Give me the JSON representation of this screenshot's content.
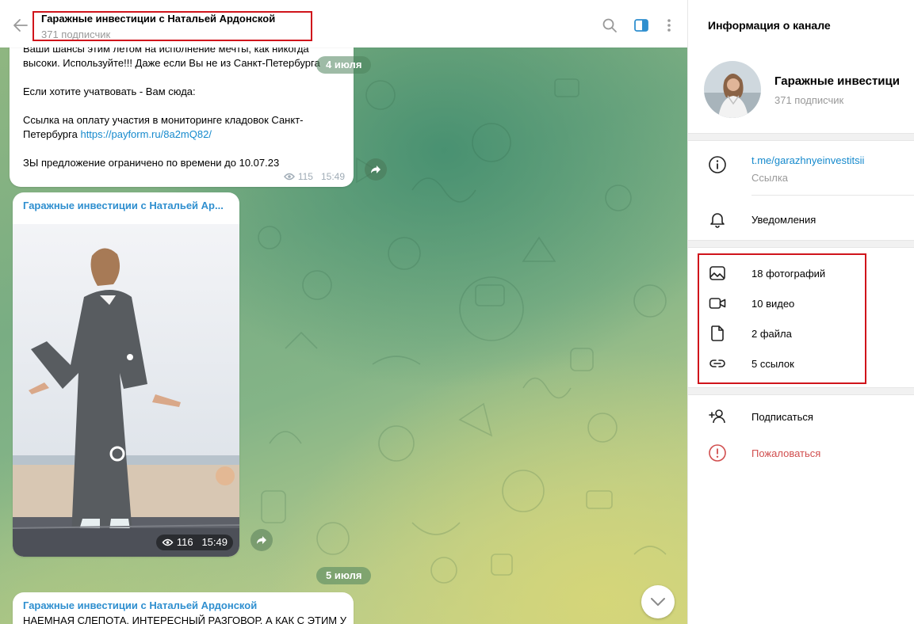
{
  "header": {
    "title": "Гаражные инвестиции с Натальей Ардонской",
    "subtitle": "371 подписчик"
  },
  "messages": {
    "m1": {
      "lines": [
        "Ваши шансы этим летом на исполнение мечты, как никогда",
        "высоки. Используйте!!! Даже если Вы не из Санкт-Петербурга",
        "Если хотите учатвовать - Вам сюда:",
        "Ссылка на оплату участия в мониторинге кладовок Санкт-",
        "Петербурга",
        "ЗЫ предложение ограничено по времени до 10.07.23"
      ],
      "link": "https://payform.ru/8a2mQ82/",
      "views": "115",
      "time": "15:49"
    },
    "date1": "4 июля",
    "m2": {
      "sender": "Гаражные инвестиции с Натальей Ар...",
      "views": "116",
      "time": "15:49"
    },
    "date2": "5 июля",
    "m3": {
      "sender": "Гаражные инвестиции с Натальей Ардонской",
      "text": "НАЕМНАЯ СЛЕПОТА. ИНТЕРЕСНЫЙ РАЗГОВОР. А КАК С ЭТИМ У"
    }
  },
  "info": {
    "title": "Информация о канале",
    "channel_name": "Гаражные инвестици",
    "subscribers": "371 подписчик",
    "link": "t.me/garazhnyeinvestitsii",
    "link_label": "Ссылка",
    "notifications": "Уведомления",
    "media": [
      {
        "icon": "photo-icon",
        "label": "18 фотографий"
      },
      {
        "icon": "video-icon",
        "label": "10 видео"
      },
      {
        "icon": "file-icon",
        "label": "2 файла"
      },
      {
        "icon": "link-icon",
        "label": "5 ссылок"
      }
    ],
    "subscribe": "Подписаться",
    "report": "Пожаловаться"
  },
  "colors": {
    "accent": "#168acd",
    "danger": "#d14e4e",
    "highlight_box": "#d0141b"
  }
}
